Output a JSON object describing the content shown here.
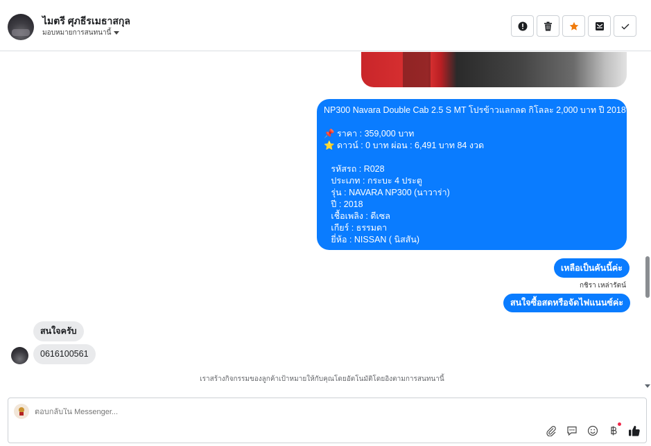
{
  "header": {
    "contact_name": "ไมตรี ศุภธีรเมธาสกุล",
    "assign_label": "มอบหมายการสนทนานี้"
  },
  "toolbar": {
    "accent_color": "#f07b0c",
    "buttons": [
      "alert-icon",
      "trash-icon",
      "star-icon",
      "mark-unread-icon",
      "check-icon"
    ]
  },
  "messages": {
    "listing_lines": [
      "NP300 Navara Double Cab 2.5 S MT โปรข้าวแลกลด กิโลละ 2,000 บาท ปี 2018",
      "",
      "📌 ราคา : 359,000 บาท",
      "⭐ ดาวน์ : 0 บาท ผ่อน : 6,491 บาท 84 งวด",
      "",
      "   รหัสรถ : R028",
      "   ประเภท : กระบะ 4 ประตู",
      "   รุ่น : NAVARA NP300 (นาวาร่า)",
      "   ปี : 2018",
      "   เชื้อเพลิง : ดีเซล",
      "   เกียร์ : ธรรมดา",
      "   ยี่ห้อ : NISSAN ( นิสสัน)"
    ],
    "out_2": "เหลือเป็นคันนี้ค่ะ",
    "agent_name": "กชิรา เหล่ารัตน์",
    "out_3": "สนใจซื้อสดหรือจัดไฟแนนซ์ค่ะ",
    "in_1": "สนใจครับ",
    "in_2": "0616100561",
    "notice": "เราสร้างกิจกรรมของลูกค้าเป้าหมายให้กับคุณโดยอัตโนมัติโดยอิงตามการสนทนานี้"
  },
  "composer": {
    "placeholder": "ตอบกลับใน Messenger..."
  },
  "colors": {
    "outgoing_bubble": "#0a7cff",
    "incoming_bubble": "#e9eaec"
  }
}
